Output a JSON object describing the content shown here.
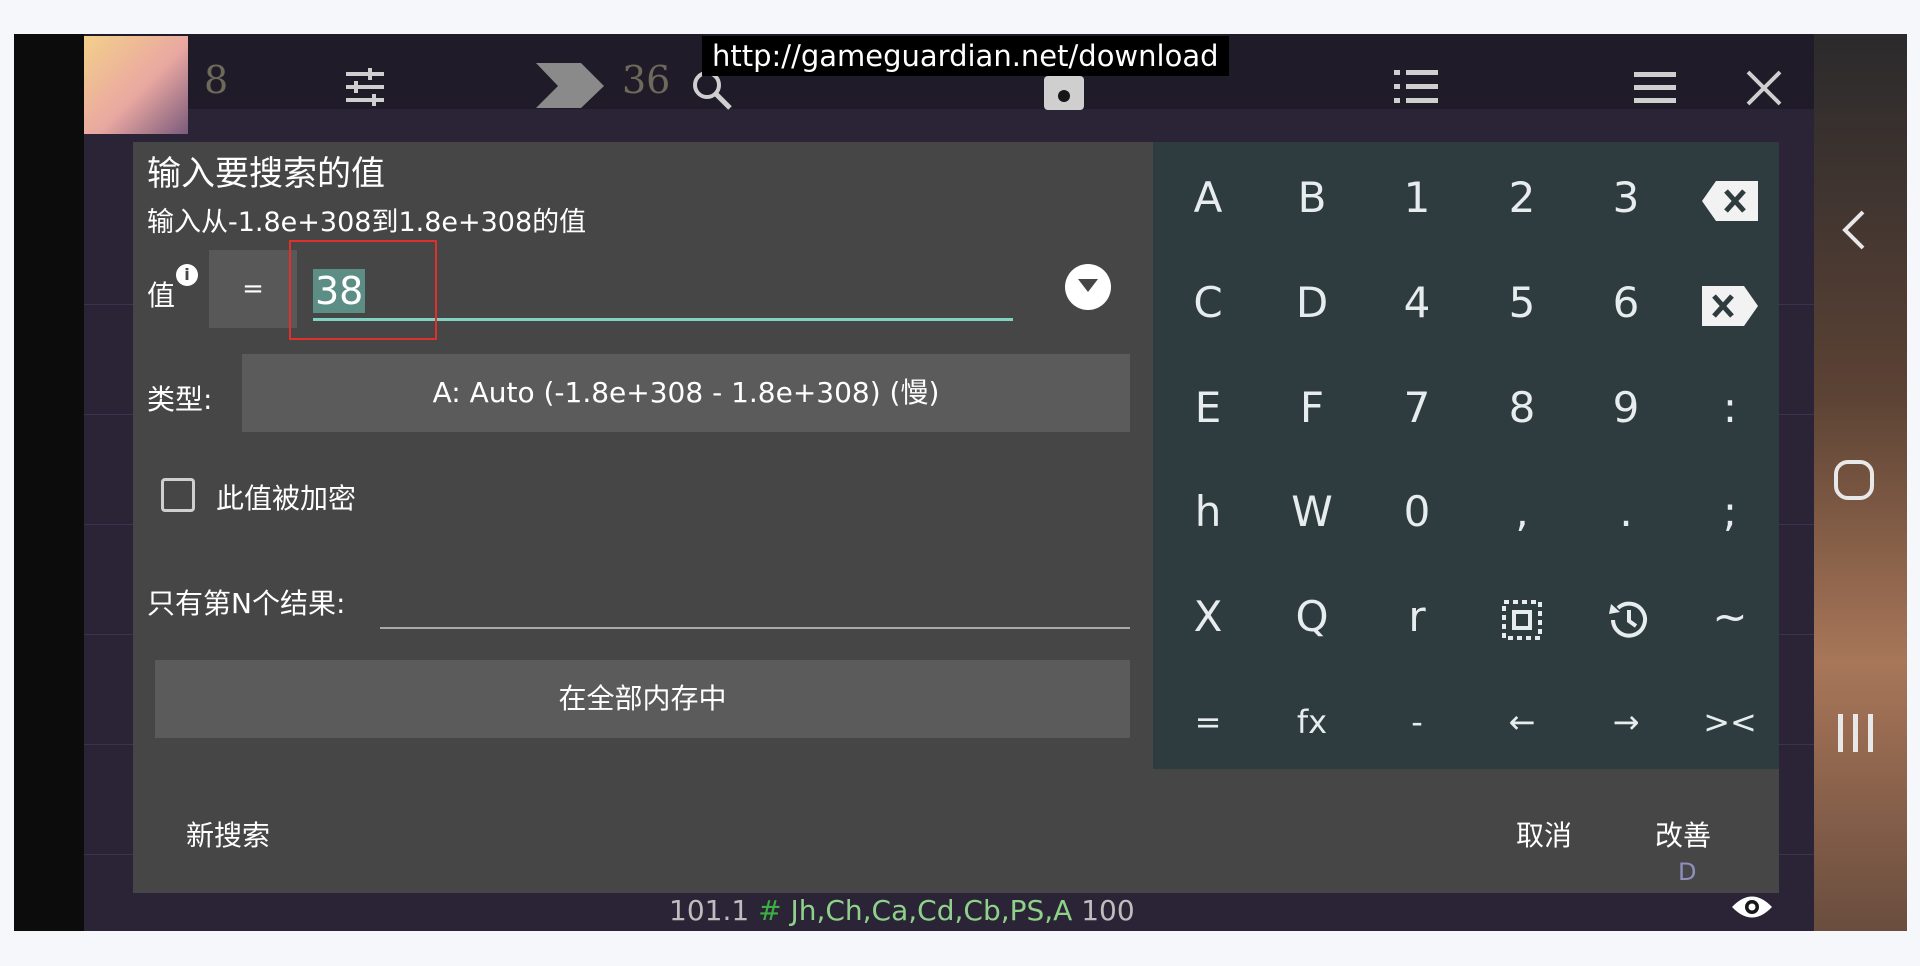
{
  "top": {
    "url": "http://gameguardian.net/download",
    "dim_numbers": [
      "8",
      "36"
    ]
  },
  "dialog": {
    "title": "输入要搜索的值",
    "subtitle": "输入从-1.8e+308到1.8e+308的值",
    "value_label": "值",
    "info_icon": "i",
    "operator": "=",
    "value": "38",
    "type_label": "类型:",
    "type_value": "A: Auto (-1.8e+308 - 1.8e+308) (慢)",
    "encrypted_label": "此值被加密",
    "nth_label": "只有第N个结果:",
    "region_button": "在全部内存中",
    "new_search": "新搜索",
    "cancel": "取消",
    "refine": "改善"
  },
  "keypad": {
    "rows": [
      [
        "A",
        "B",
        "1",
        "2",
        "3",
        "backspace-icon"
      ],
      [
        "C",
        "D",
        "4",
        "5",
        "6",
        "clear-icon"
      ],
      [
        "E",
        "F",
        "7",
        "8",
        "9",
        ":"
      ],
      [
        "h",
        "W",
        "0",
        ",",
        ".",
        ";"
      ],
      [
        "X",
        "Q",
        "r",
        "select-all-icon",
        "history-icon",
        "~"
      ],
      [
        "=",
        "fx",
        "-",
        "←",
        "→",
        "><"
      ]
    ]
  },
  "status": {
    "value": "101.1",
    "hash": "#",
    "regions": "Jh,Ch,Ca,Cd,Cb,PS,A",
    "count": "100",
    "d_mark": "D"
  },
  "colors": {
    "dialog_bg": "#464646",
    "keypad_bg": "#2f3c3f",
    "accent_underline": "#7fd3c3",
    "highlight_box": "#e0302c"
  }
}
